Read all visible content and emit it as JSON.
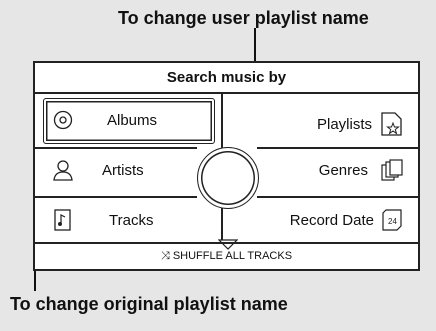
{
  "annotations": {
    "top": "To change user playlist name",
    "bottom": "To change original playlist name"
  },
  "screen": {
    "header": "Search music by",
    "items": {
      "albums": "Albums",
      "artists": "Artists",
      "tracks": "Tracks",
      "playlists": "Playlists",
      "genres": "Genres",
      "record_date": "Record Date"
    },
    "footer": "SHUFFLE ALL TRACKS",
    "shuffle_glyph": "⤨"
  }
}
